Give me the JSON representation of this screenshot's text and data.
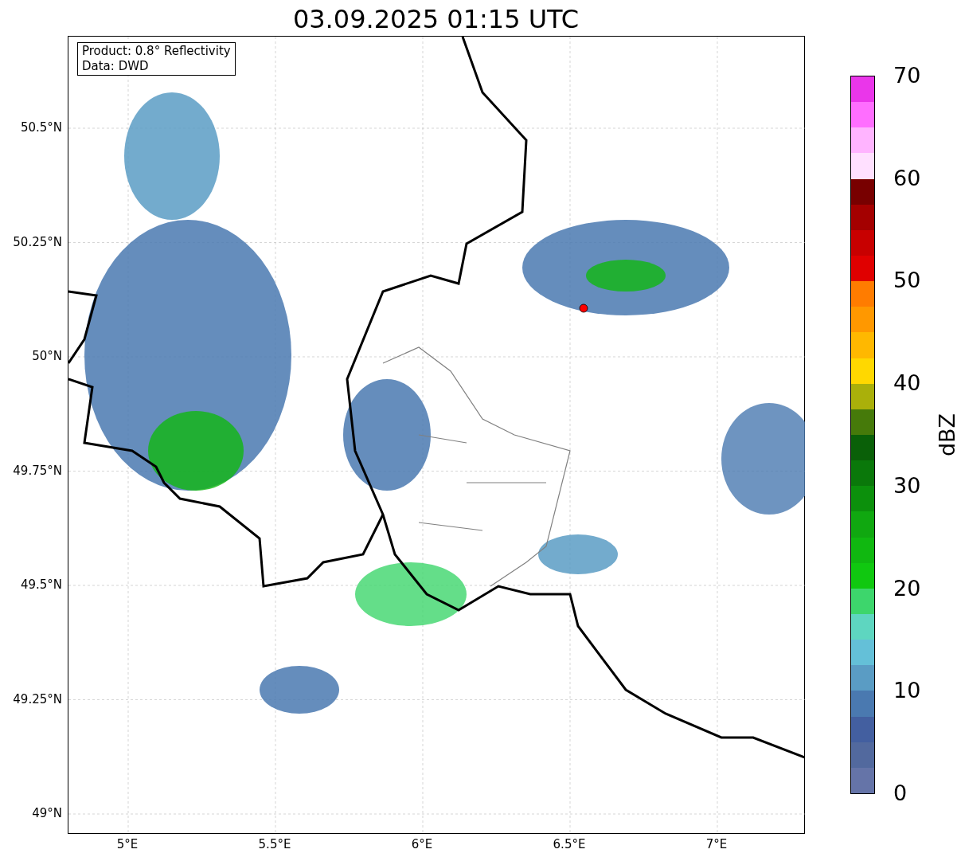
{
  "title": "03.09.2025 01:15 UTC",
  "legend": [
    "Product: 0.8° Reflectivity",
    "Data: DWD"
  ],
  "y_ticks": [
    "50.5°N",
    "50.25°N",
    "50°N",
    "49.75°N",
    "49.5°N",
    "49.25°N",
    "49°N"
  ],
  "x_ticks": [
    "5°E",
    "5.5°E",
    "6°E",
    "6.5°E",
    "7°E"
  ],
  "colorbar": {
    "label": "dBZ",
    "ticks": [
      "70",
      "60",
      "50",
      "40",
      "30",
      "20",
      "10",
      "0"
    ],
    "segments": [
      {
        "color": "#6574a8"
      },
      {
        "color": "#52699e"
      },
      {
        "color": "#435fa0"
      },
      {
        "color": "#4a79b0"
      },
      {
        "color": "#5a9cc4"
      },
      {
        "color": "#64c0d8"
      },
      {
        "color": "#5ed6c0"
      },
      {
        "color": "#3dd66c"
      },
      {
        "color": "#10c810"
      },
      {
        "color": "#10b810"
      },
      {
        "color": "#10a810"
      },
      {
        "color": "#0c900c"
      },
      {
        "color": "#0a780a"
      },
      {
        "color": "#0a6008"
      },
      {
        "color": "#467a0a"
      },
      {
        "color": "#aab00a"
      },
      {
        "color": "#ffd800"
      },
      {
        "color": "#ffb800"
      },
      {
        "color": "#ff9800"
      },
      {
        "color": "#ff7c00"
      },
      {
        "color": "#e00000"
      },
      {
        "color": "#c80000"
      },
      {
        "color": "#a40000"
      },
      {
        "color": "#780000"
      },
      {
        "color": "#ffe0ff"
      },
      {
        "color": "#ffb4ff"
      },
      {
        "color": "#ff6eff"
      },
      {
        "color": "#ea36ea"
      }
    ]
  }
}
